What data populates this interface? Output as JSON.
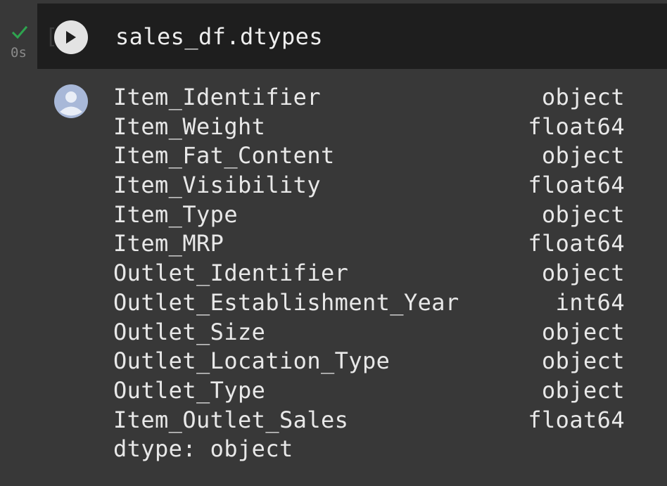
{
  "cell": {
    "execution_count": "[ ]",
    "exec_time": "0s",
    "code": "sales_df.dtypes"
  },
  "icons": {
    "status": "checkmark-icon",
    "run": "play-icon",
    "output_avatar": "user-avatar-icon"
  },
  "colors": {
    "status_ok": "#2ea44f",
    "input_bg": "#1e1e1e",
    "output_bg": "#383838"
  },
  "output": {
    "rows": [
      {
        "name": "Item_Identifier",
        "dtype": "object"
      },
      {
        "name": "Item_Weight",
        "dtype": "float64"
      },
      {
        "name": "Item_Fat_Content",
        "dtype": "object"
      },
      {
        "name": "Item_Visibility",
        "dtype": "float64"
      },
      {
        "name": "Item_Type",
        "dtype": "object"
      },
      {
        "name": "Item_MRP",
        "dtype": "float64"
      },
      {
        "name": "Outlet_Identifier",
        "dtype": "object"
      },
      {
        "name": "Outlet_Establishment_Year",
        "dtype": "int64"
      },
      {
        "name": "Outlet_Size",
        "dtype": "object"
      },
      {
        "name": "Outlet_Location_Type",
        "dtype": "object"
      },
      {
        "name": "Outlet_Type",
        "dtype": "object"
      },
      {
        "name": "Item_Outlet_Sales",
        "dtype": "float64"
      }
    ],
    "footer": "dtype: object"
  }
}
